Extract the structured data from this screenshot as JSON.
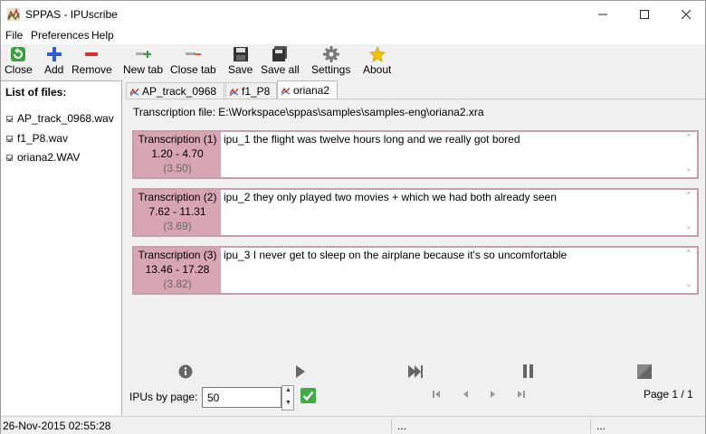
{
  "window": {
    "title": "SPPAS - IPUscribe"
  },
  "menu": [
    "File",
    "Preferences",
    "Help"
  ],
  "toolbar": {
    "close": "Close",
    "add": "Add",
    "remove": "Remove",
    "new_tab": "New tab",
    "close_tab": "Close tab",
    "save": "Save",
    "save_all": "Save all",
    "settings": "Settings",
    "about": "About"
  },
  "files": {
    "title": "List of files:",
    "items": [
      "AP_track_0968.wav",
      "f1_P8.wav",
      "oriana2.WAV"
    ]
  },
  "tabs": [
    "AP_track_0968",
    "f1_P8",
    "oriana2"
  ],
  "content": {
    "transcription_file": "Transcription file: E:\\Workspace\\sppas\\samples\\samples-eng\\oriana2.xra",
    "ipus": [
      {
        "label": "Transcription (1)",
        "times": "1.20 -   4.70",
        "duration": "(3.50)",
        "text": "ipu_1 the flight was twelve hours long and we really got bored"
      },
      {
        "label": "Transcription (2)",
        "times": "7.62 -  11.31",
        "duration": "(3.69)",
        "text": "ipu_2 they only played two movies + which we had both already seen"
      },
      {
        "label": "Transcription (3)",
        "times": "13.46 -  17.28",
        "duration": "(3.82)",
        "text": "ipu_3 I never get to sleep on the airplane because it's so uncomfortable"
      }
    ]
  },
  "controls": {
    "ipus_by_page_label": "IPUs by page:",
    "ipus_by_page_value": "50",
    "page": "Page 1 / 1"
  },
  "status": {
    "datetime": "26-Nov-2015 02:55:28",
    "field2": "...",
    "field3": "..."
  }
}
